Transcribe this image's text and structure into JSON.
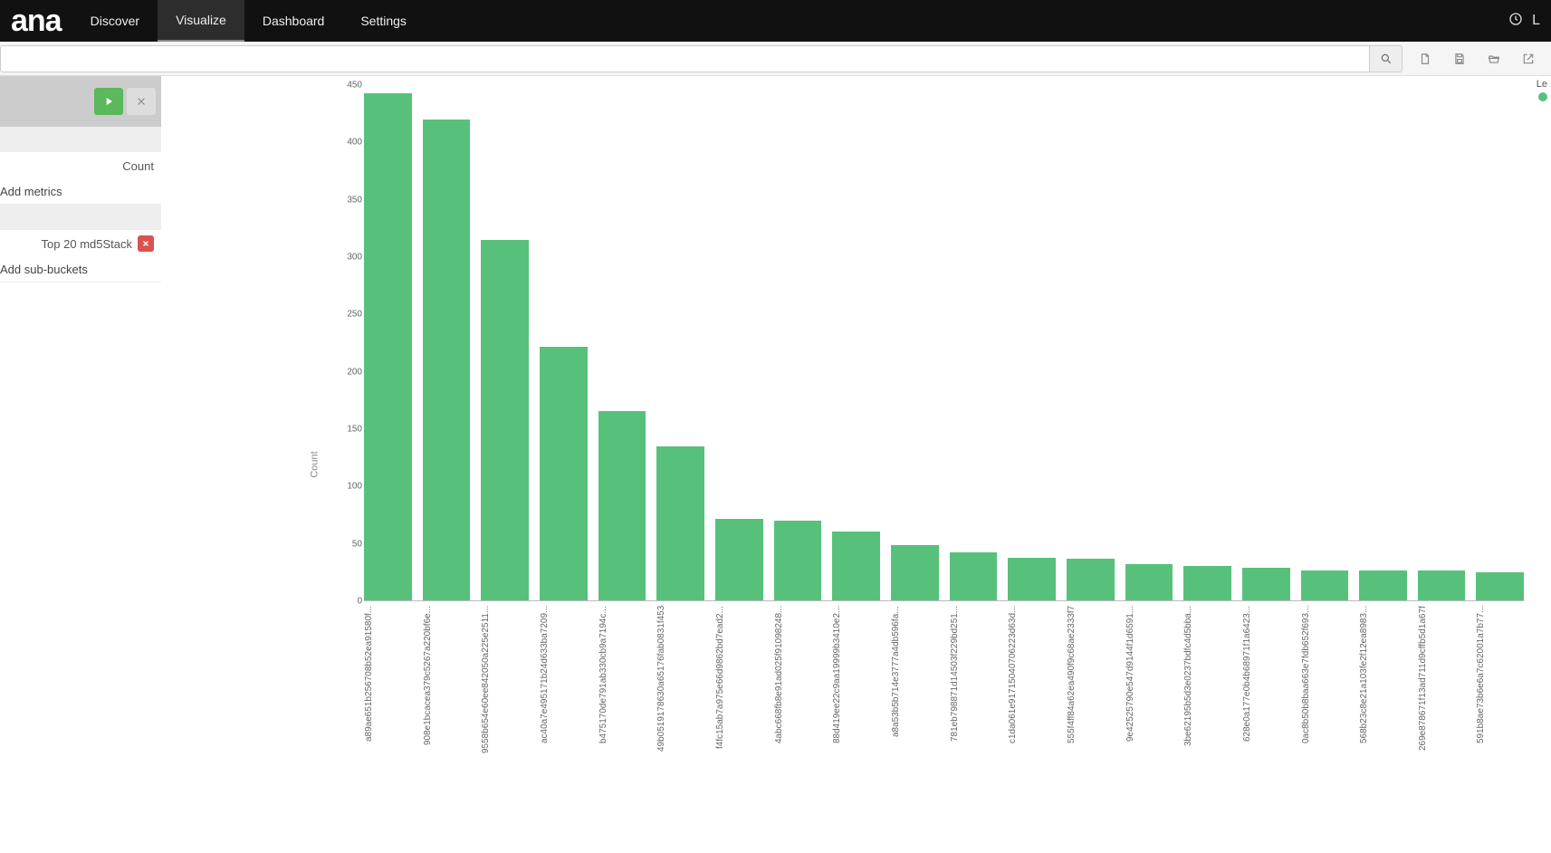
{
  "app": {
    "logo_text": "ana"
  },
  "nav": {
    "items": [
      {
        "label": "Discover"
      },
      {
        "label": "Visualize",
        "active": true
      },
      {
        "label": "Dashboard"
      },
      {
        "label": "Settings"
      }
    ],
    "right_label": "L"
  },
  "search": {
    "query": "",
    "placeholder": ""
  },
  "toolbar_icons": [
    "new",
    "save",
    "open",
    "share"
  ],
  "sidebar": {
    "metrics": {
      "agg_label": "Count",
      "add_label": "Add metrics"
    },
    "buckets": {
      "x_axis_label": "Top 20 md5Stack",
      "add_label": "Add sub-buckets"
    }
  },
  "legend": {
    "title_fragment": "Le"
  },
  "chart_data": {
    "type": "bar",
    "ylabel": "Count",
    "xlabel": "",
    "ylim": [
      0,
      450
    ],
    "y_ticks": [
      0,
      50,
      100,
      150,
      200,
      250,
      300,
      350,
      400,
      450
    ],
    "categories": [
      "a89ae651b256708b52ea91580f...",
      "908e1bcacea379c5267a220bf6e...",
      "9558b654e60ee842050a225e2511...",
      "ac40a7e495171b24d633ba7209...",
      "b475170de791ab330cb9a7194c...",
      "49b0519178630a65176fab0831f453",
      "f4fc15ab7a975e66d9862bd7ead2...",
      "4abc668fb8e91ad025f91098248...",
      "88d419ee22c9aa19999b3410e2...",
      "a8a53b5b714e3777a4db596fa...",
      "781eb798871d14503f229bd251...",
      "c1da061e91715040706223d63d...",
      "555f4ff84a62ea490f9c68ae2333f7",
      "9e42525790e547d9144f1d6591...",
      "3be62195b5d3e0237bdfc4d5bba...",
      "628e0a177e0b4b68971f1a6423...",
      "0ac8b50b8baa663e7fdb652f693...",
      "568b23c8e21a103fe2f12ea8983...",
      "269e878671f13ad711d9cffb5d1a67f",
      "591b8ae73b6e6a7c62001a7b77..."
    ],
    "values": [
      443,
      420,
      315,
      222,
      166,
      135,
      72,
      70,
      61,
      49,
      43,
      38,
      37,
      32,
      31,
      29,
      27,
      27,
      27,
      25
    ],
    "series_color": "#57c17b"
  }
}
